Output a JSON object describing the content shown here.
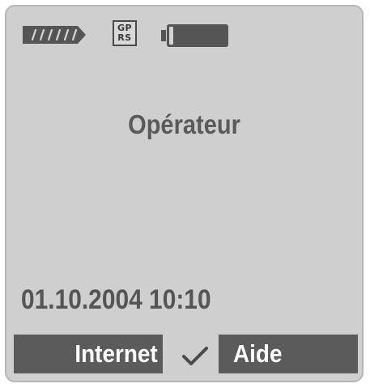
{
  "status_bar": {
    "signal_icon": "signal-strength-icon",
    "gprs": {
      "line1": "GP",
      "line2": "RS"
    },
    "battery_icon": "battery-icon"
  },
  "main": {
    "operator": "Opérateur",
    "datetime": "01.10.2004 10:10"
  },
  "softkeys": {
    "left_label": "Internet",
    "center_icon": "checkmark-icon",
    "right_label": "Aide"
  },
  "colors": {
    "screen_background": "#cfcfcf",
    "text": "#555555",
    "softkey_background": "#5b5b5b",
    "softkey_text": "#ffffff"
  }
}
